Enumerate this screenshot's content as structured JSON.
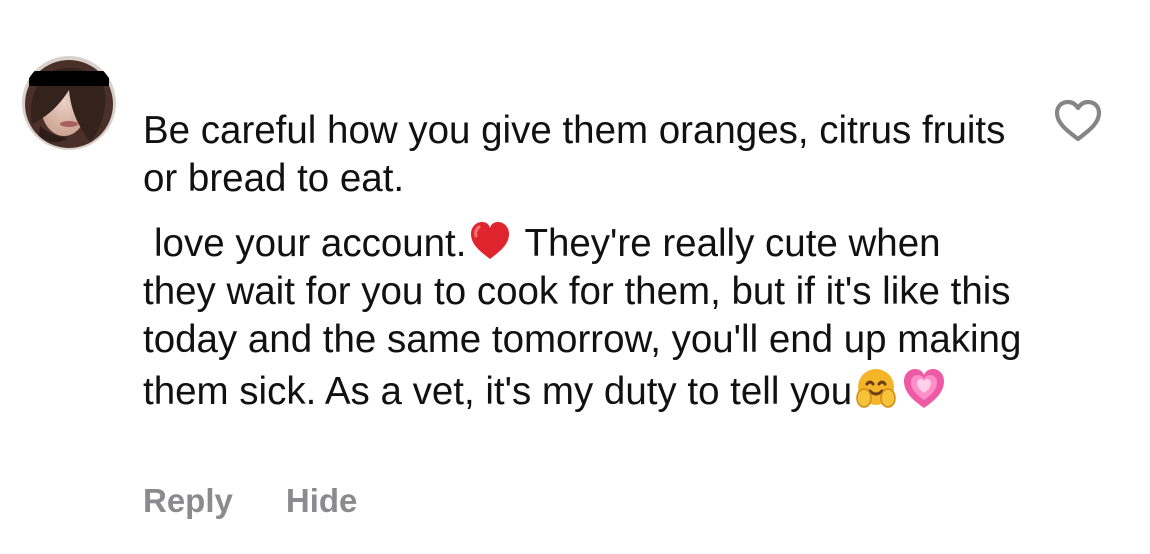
{
  "comment": {
    "avatar_icon": "user-avatar",
    "paragraphs": [
      "Be careful how you give them oranges, citrus fruits or bread to eat.",
      "love your account."
    ],
    "paragraph_two_tail": " They're really cute when they wait for you to cook for them, but if it's like this today and the same tomorrow, you'll end up making them sick. As a vet, it's my duty to tell you",
    "emojis": [
      "red-heart-icon",
      "hugging-face-icon",
      "growing-heart-icon"
    ],
    "like_icon": "heart-outline-icon"
  },
  "actions": {
    "reply_label": "Reply",
    "hide_label": "Hide"
  },
  "colors": {
    "text": "#111111",
    "secondary_text": "#8b8b8f",
    "heart_red": "#e0242d",
    "hug_yellow": "#f4b52b",
    "pink_heart": "#ef5aa4"
  }
}
